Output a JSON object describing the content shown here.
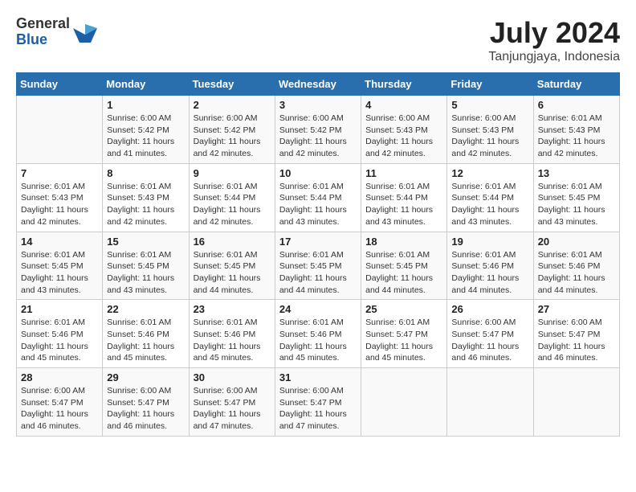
{
  "logo": {
    "general": "General",
    "blue": "Blue"
  },
  "title": {
    "month_year": "July 2024",
    "location": "Tanjungjaya, Indonesia"
  },
  "weekdays": [
    "Sunday",
    "Monday",
    "Tuesday",
    "Wednesday",
    "Thursday",
    "Friday",
    "Saturday"
  ],
  "weeks": [
    [
      {
        "day": "",
        "sunrise": "",
        "sunset": "",
        "daylight": ""
      },
      {
        "day": "1",
        "sunrise": "Sunrise: 6:00 AM",
        "sunset": "Sunset: 5:42 PM",
        "daylight": "Daylight: 11 hours and 41 minutes."
      },
      {
        "day": "2",
        "sunrise": "Sunrise: 6:00 AM",
        "sunset": "Sunset: 5:42 PM",
        "daylight": "Daylight: 11 hours and 42 minutes."
      },
      {
        "day": "3",
        "sunrise": "Sunrise: 6:00 AM",
        "sunset": "Sunset: 5:42 PM",
        "daylight": "Daylight: 11 hours and 42 minutes."
      },
      {
        "day": "4",
        "sunrise": "Sunrise: 6:00 AM",
        "sunset": "Sunset: 5:43 PM",
        "daylight": "Daylight: 11 hours and 42 minutes."
      },
      {
        "day": "5",
        "sunrise": "Sunrise: 6:00 AM",
        "sunset": "Sunset: 5:43 PM",
        "daylight": "Daylight: 11 hours and 42 minutes."
      },
      {
        "day": "6",
        "sunrise": "Sunrise: 6:01 AM",
        "sunset": "Sunset: 5:43 PM",
        "daylight": "Daylight: 11 hours and 42 minutes."
      }
    ],
    [
      {
        "day": "7",
        "sunrise": "Sunrise: 6:01 AM",
        "sunset": "Sunset: 5:43 PM",
        "daylight": "Daylight: 11 hours and 42 minutes."
      },
      {
        "day": "8",
        "sunrise": "Sunrise: 6:01 AM",
        "sunset": "Sunset: 5:43 PM",
        "daylight": "Daylight: 11 hours and 42 minutes."
      },
      {
        "day": "9",
        "sunrise": "Sunrise: 6:01 AM",
        "sunset": "Sunset: 5:44 PM",
        "daylight": "Daylight: 11 hours and 42 minutes."
      },
      {
        "day": "10",
        "sunrise": "Sunrise: 6:01 AM",
        "sunset": "Sunset: 5:44 PM",
        "daylight": "Daylight: 11 hours and 43 minutes."
      },
      {
        "day": "11",
        "sunrise": "Sunrise: 6:01 AM",
        "sunset": "Sunset: 5:44 PM",
        "daylight": "Daylight: 11 hours and 43 minutes."
      },
      {
        "day": "12",
        "sunrise": "Sunrise: 6:01 AM",
        "sunset": "Sunset: 5:44 PM",
        "daylight": "Daylight: 11 hours and 43 minutes."
      },
      {
        "day": "13",
        "sunrise": "Sunrise: 6:01 AM",
        "sunset": "Sunset: 5:45 PM",
        "daylight": "Daylight: 11 hours and 43 minutes."
      }
    ],
    [
      {
        "day": "14",
        "sunrise": "Sunrise: 6:01 AM",
        "sunset": "Sunset: 5:45 PM",
        "daylight": "Daylight: 11 hours and 43 minutes."
      },
      {
        "day": "15",
        "sunrise": "Sunrise: 6:01 AM",
        "sunset": "Sunset: 5:45 PM",
        "daylight": "Daylight: 11 hours and 43 minutes."
      },
      {
        "day": "16",
        "sunrise": "Sunrise: 6:01 AM",
        "sunset": "Sunset: 5:45 PM",
        "daylight": "Daylight: 11 hours and 44 minutes."
      },
      {
        "day": "17",
        "sunrise": "Sunrise: 6:01 AM",
        "sunset": "Sunset: 5:45 PM",
        "daylight": "Daylight: 11 hours and 44 minutes."
      },
      {
        "day": "18",
        "sunrise": "Sunrise: 6:01 AM",
        "sunset": "Sunset: 5:45 PM",
        "daylight": "Daylight: 11 hours and 44 minutes."
      },
      {
        "day": "19",
        "sunrise": "Sunrise: 6:01 AM",
        "sunset": "Sunset: 5:46 PM",
        "daylight": "Daylight: 11 hours and 44 minutes."
      },
      {
        "day": "20",
        "sunrise": "Sunrise: 6:01 AM",
        "sunset": "Sunset: 5:46 PM",
        "daylight": "Daylight: 11 hours and 44 minutes."
      }
    ],
    [
      {
        "day": "21",
        "sunrise": "Sunrise: 6:01 AM",
        "sunset": "Sunset: 5:46 PM",
        "daylight": "Daylight: 11 hours and 45 minutes."
      },
      {
        "day": "22",
        "sunrise": "Sunrise: 6:01 AM",
        "sunset": "Sunset: 5:46 PM",
        "daylight": "Daylight: 11 hours and 45 minutes."
      },
      {
        "day": "23",
        "sunrise": "Sunrise: 6:01 AM",
        "sunset": "Sunset: 5:46 PM",
        "daylight": "Daylight: 11 hours and 45 minutes."
      },
      {
        "day": "24",
        "sunrise": "Sunrise: 6:01 AM",
        "sunset": "Sunset: 5:46 PM",
        "daylight": "Daylight: 11 hours and 45 minutes."
      },
      {
        "day": "25",
        "sunrise": "Sunrise: 6:01 AM",
        "sunset": "Sunset: 5:47 PM",
        "daylight": "Daylight: 11 hours and 45 minutes."
      },
      {
        "day": "26",
        "sunrise": "Sunrise: 6:00 AM",
        "sunset": "Sunset: 5:47 PM",
        "daylight": "Daylight: 11 hours and 46 minutes."
      },
      {
        "day": "27",
        "sunrise": "Sunrise: 6:00 AM",
        "sunset": "Sunset: 5:47 PM",
        "daylight": "Daylight: 11 hours and 46 minutes."
      }
    ],
    [
      {
        "day": "28",
        "sunrise": "Sunrise: 6:00 AM",
        "sunset": "Sunset: 5:47 PM",
        "daylight": "Daylight: 11 hours and 46 minutes."
      },
      {
        "day": "29",
        "sunrise": "Sunrise: 6:00 AM",
        "sunset": "Sunset: 5:47 PM",
        "daylight": "Daylight: 11 hours and 46 minutes."
      },
      {
        "day": "30",
        "sunrise": "Sunrise: 6:00 AM",
        "sunset": "Sunset: 5:47 PM",
        "daylight": "Daylight: 11 hours and 47 minutes."
      },
      {
        "day": "31",
        "sunrise": "Sunrise: 6:00 AM",
        "sunset": "Sunset: 5:47 PM",
        "daylight": "Daylight: 11 hours and 47 minutes."
      },
      {
        "day": "",
        "sunrise": "",
        "sunset": "",
        "daylight": ""
      },
      {
        "day": "",
        "sunrise": "",
        "sunset": "",
        "daylight": ""
      },
      {
        "day": "",
        "sunrise": "",
        "sunset": "",
        "daylight": ""
      }
    ]
  ]
}
